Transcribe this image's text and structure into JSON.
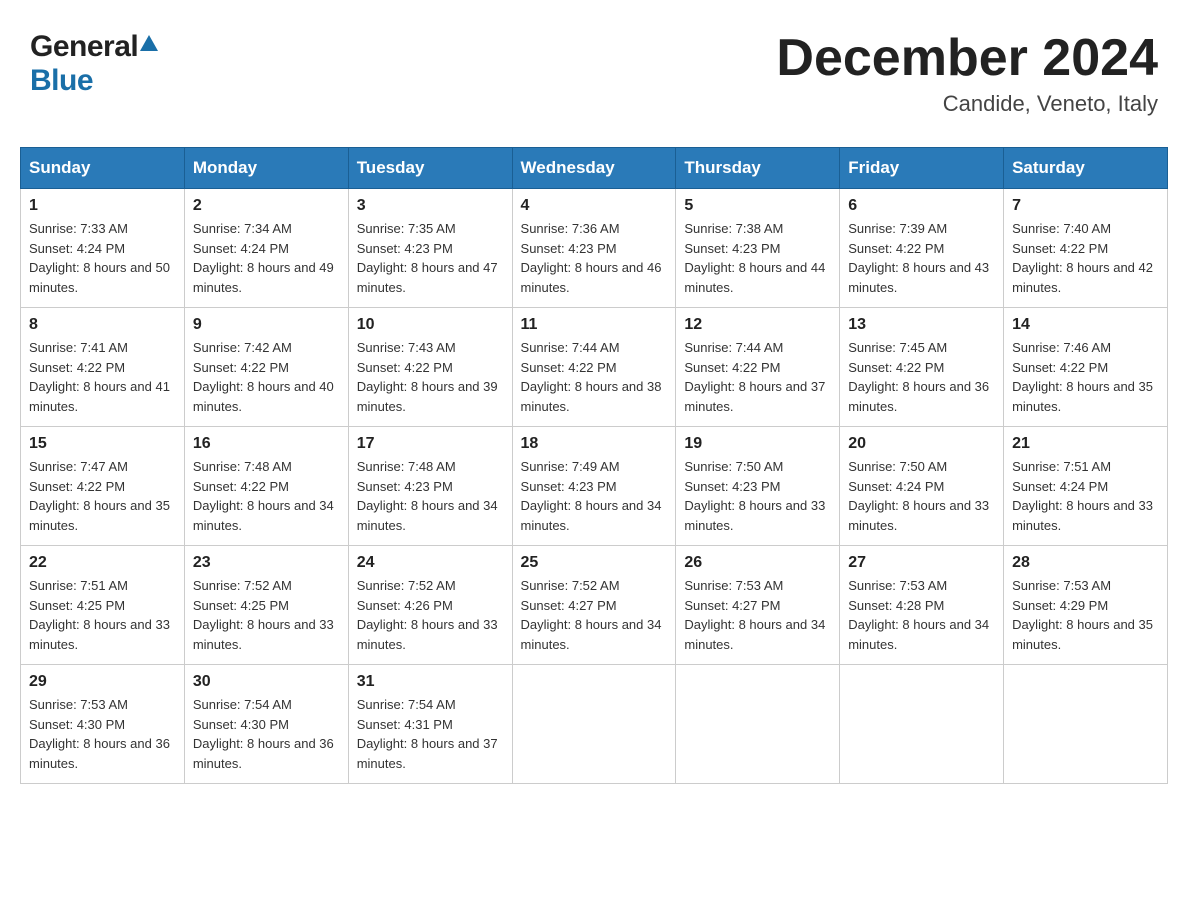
{
  "header": {
    "logo_general": "General",
    "logo_blue": "Blue",
    "title": "December 2024",
    "subtitle": "Candide, Veneto, Italy"
  },
  "days_of_week": [
    "Sunday",
    "Monday",
    "Tuesday",
    "Wednesday",
    "Thursday",
    "Friday",
    "Saturday"
  ],
  "weeks": [
    [
      {
        "day": "1",
        "sunrise": "7:33 AM",
        "sunset": "4:24 PM",
        "daylight": "8 hours and 50 minutes."
      },
      {
        "day": "2",
        "sunrise": "7:34 AM",
        "sunset": "4:24 PM",
        "daylight": "8 hours and 49 minutes."
      },
      {
        "day": "3",
        "sunrise": "7:35 AM",
        "sunset": "4:23 PM",
        "daylight": "8 hours and 47 minutes."
      },
      {
        "day": "4",
        "sunrise": "7:36 AM",
        "sunset": "4:23 PM",
        "daylight": "8 hours and 46 minutes."
      },
      {
        "day": "5",
        "sunrise": "7:38 AM",
        "sunset": "4:23 PM",
        "daylight": "8 hours and 44 minutes."
      },
      {
        "day": "6",
        "sunrise": "7:39 AM",
        "sunset": "4:22 PM",
        "daylight": "8 hours and 43 minutes."
      },
      {
        "day": "7",
        "sunrise": "7:40 AM",
        "sunset": "4:22 PM",
        "daylight": "8 hours and 42 minutes."
      }
    ],
    [
      {
        "day": "8",
        "sunrise": "7:41 AM",
        "sunset": "4:22 PM",
        "daylight": "8 hours and 41 minutes."
      },
      {
        "day": "9",
        "sunrise": "7:42 AM",
        "sunset": "4:22 PM",
        "daylight": "8 hours and 40 minutes."
      },
      {
        "day": "10",
        "sunrise": "7:43 AM",
        "sunset": "4:22 PM",
        "daylight": "8 hours and 39 minutes."
      },
      {
        "day": "11",
        "sunrise": "7:44 AM",
        "sunset": "4:22 PM",
        "daylight": "8 hours and 38 minutes."
      },
      {
        "day": "12",
        "sunrise": "7:44 AM",
        "sunset": "4:22 PM",
        "daylight": "8 hours and 37 minutes."
      },
      {
        "day": "13",
        "sunrise": "7:45 AM",
        "sunset": "4:22 PM",
        "daylight": "8 hours and 36 minutes."
      },
      {
        "day": "14",
        "sunrise": "7:46 AM",
        "sunset": "4:22 PM",
        "daylight": "8 hours and 35 minutes."
      }
    ],
    [
      {
        "day": "15",
        "sunrise": "7:47 AM",
        "sunset": "4:22 PM",
        "daylight": "8 hours and 35 minutes."
      },
      {
        "day": "16",
        "sunrise": "7:48 AM",
        "sunset": "4:22 PM",
        "daylight": "8 hours and 34 minutes."
      },
      {
        "day": "17",
        "sunrise": "7:48 AM",
        "sunset": "4:23 PM",
        "daylight": "8 hours and 34 minutes."
      },
      {
        "day": "18",
        "sunrise": "7:49 AM",
        "sunset": "4:23 PM",
        "daylight": "8 hours and 34 minutes."
      },
      {
        "day": "19",
        "sunrise": "7:50 AM",
        "sunset": "4:23 PM",
        "daylight": "8 hours and 33 minutes."
      },
      {
        "day": "20",
        "sunrise": "7:50 AM",
        "sunset": "4:24 PM",
        "daylight": "8 hours and 33 minutes."
      },
      {
        "day": "21",
        "sunrise": "7:51 AM",
        "sunset": "4:24 PM",
        "daylight": "8 hours and 33 minutes."
      }
    ],
    [
      {
        "day": "22",
        "sunrise": "7:51 AM",
        "sunset": "4:25 PM",
        "daylight": "8 hours and 33 minutes."
      },
      {
        "day": "23",
        "sunrise": "7:52 AM",
        "sunset": "4:25 PM",
        "daylight": "8 hours and 33 minutes."
      },
      {
        "day": "24",
        "sunrise": "7:52 AM",
        "sunset": "4:26 PM",
        "daylight": "8 hours and 33 minutes."
      },
      {
        "day": "25",
        "sunrise": "7:52 AM",
        "sunset": "4:27 PM",
        "daylight": "8 hours and 34 minutes."
      },
      {
        "day": "26",
        "sunrise": "7:53 AM",
        "sunset": "4:27 PM",
        "daylight": "8 hours and 34 minutes."
      },
      {
        "day": "27",
        "sunrise": "7:53 AM",
        "sunset": "4:28 PM",
        "daylight": "8 hours and 34 minutes."
      },
      {
        "day": "28",
        "sunrise": "7:53 AM",
        "sunset": "4:29 PM",
        "daylight": "8 hours and 35 minutes."
      }
    ],
    [
      {
        "day": "29",
        "sunrise": "7:53 AM",
        "sunset": "4:30 PM",
        "daylight": "8 hours and 36 minutes."
      },
      {
        "day": "30",
        "sunrise": "7:54 AM",
        "sunset": "4:30 PM",
        "daylight": "8 hours and 36 minutes."
      },
      {
        "day": "31",
        "sunrise": "7:54 AM",
        "sunset": "4:31 PM",
        "daylight": "8 hours and 37 minutes."
      },
      null,
      null,
      null,
      null
    ]
  ],
  "labels": {
    "sunrise": "Sunrise:",
    "sunset": "Sunset:",
    "daylight": "Daylight:"
  }
}
